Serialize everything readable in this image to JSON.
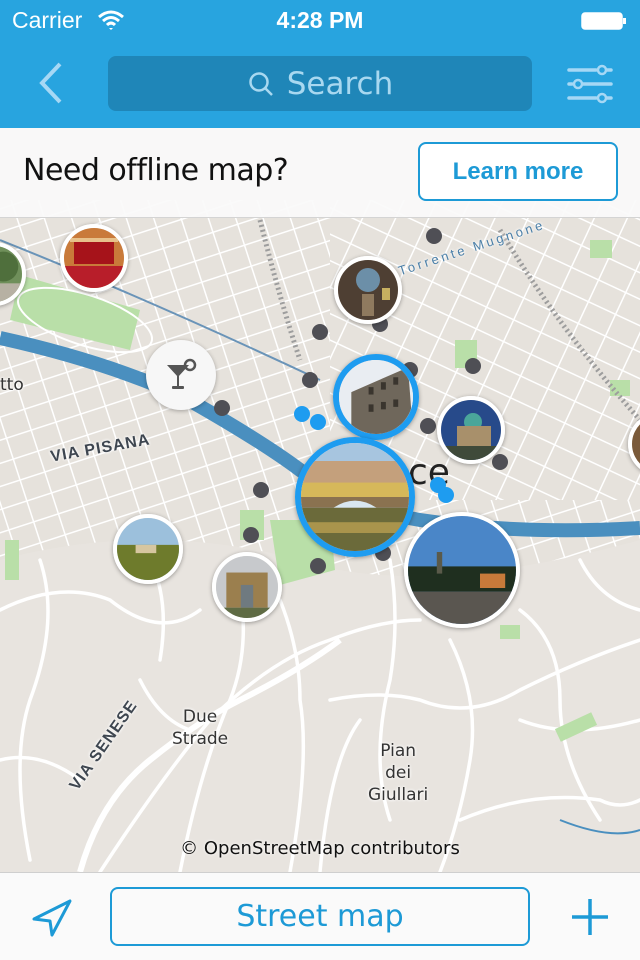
{
  "status_bar": {
    "carrier": "Carrier",
    "time": "4:28 PM",
    "wifi_icon": "wifi-icon",
    "battery_icon": "battery-icon"
  },
  "navbar": {
    "back_icon": "chevron-left-icon",
    "search_placeholder": "Search",
    "search_value": "",
    "filter_icon": "sliders-icon"
  },
  "banner": {
    "text": "Need offline map?",
    "button_label": "Learn more"
  },
  "map": {
    "city_label_partial": "ce",
    "labels": [
      {
        "id": "due-strade",
        "text": "Due\nStrade"
      },
      {
        "id": "pian-dei-giullari",
        "text": "Pian\ndei\nGiullari"
      },
      {
        "id": "left-edge",
        "text": "tto"
      }
    ],
    "road_labels": [
      "VIA PISANA",
      "VIA SENESE",
      "Torrente Mugnone"
    ],
    "attribution": "© OpenStreetMap contributors",
    "poi_icon": "cocktail-glass-icon",
    "photo_pins": [
      {
        "id": "garden",
        "selected": false
      },
      {
        "id": "theater",
        "selected": false
      },
      {
        "id": "chapel-dome",
        "selected": false
      },
      {
        "id": "palazzo",
        "selected": true
      },
      {
        "id": "synagogue",
        "selected": false
      },
      {
        "id": "ponte-vecchio",
        "selected": true
      },
      {
        "id": "hillside-villa",
        "selected": false
      },
      {
        "id": "city-gate",
        "selected": false
      },
      {
        "id": "piazzale-michelangelo",
        "selected": false
      }
    ]
  },
  "toolbar": {
    "location_icon": "location-arrow-icon",
    "map_type_label": "Street map",
    "add_icon": "plus-icon"
  },
  "colors": {
    "accent": "#28a4df",
    "button_blue": "#1d9ad6",
    "selected_pin": "#1e9cf0",
    "cluster_dot": "#4f4f55",
    "river": "#4a8fbf",
    "park": "#b9dfa8"
  }
}
